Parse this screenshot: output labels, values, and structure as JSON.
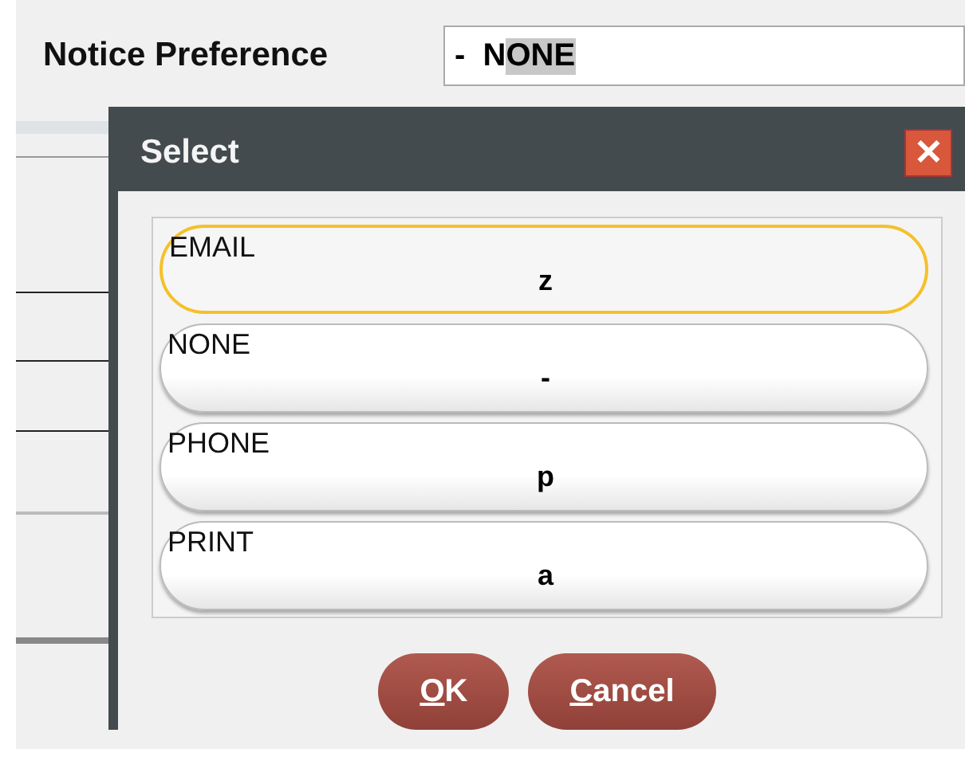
{
  "form": {
    "label": "Notice Preference",
    "field": {
      "value": "-  N",
      "selection": "ONE"
    }
  },
  "dialog": {
    "title": "Select",
    "close": "✕",
    "options": [
      {
        "name": "EMAIL",
        "code": "z",
        "selected": true
      },
      {
        "name": "NONE",
        "code": "-",
        "selected": false
      },
      {
        "name": "PHONE",
        "code": "p",
        "selected": false
      },
      {
        "name": "PRINT",
        "code": "a",
        "selected": false
      }
    ],
    "buttons": [
      {
        "mnemonic": "O",
        "rest": "K"
      },
      {
        "mnemonic": "C",
        "rest": "ancel"
      }
    ]
  }
}
